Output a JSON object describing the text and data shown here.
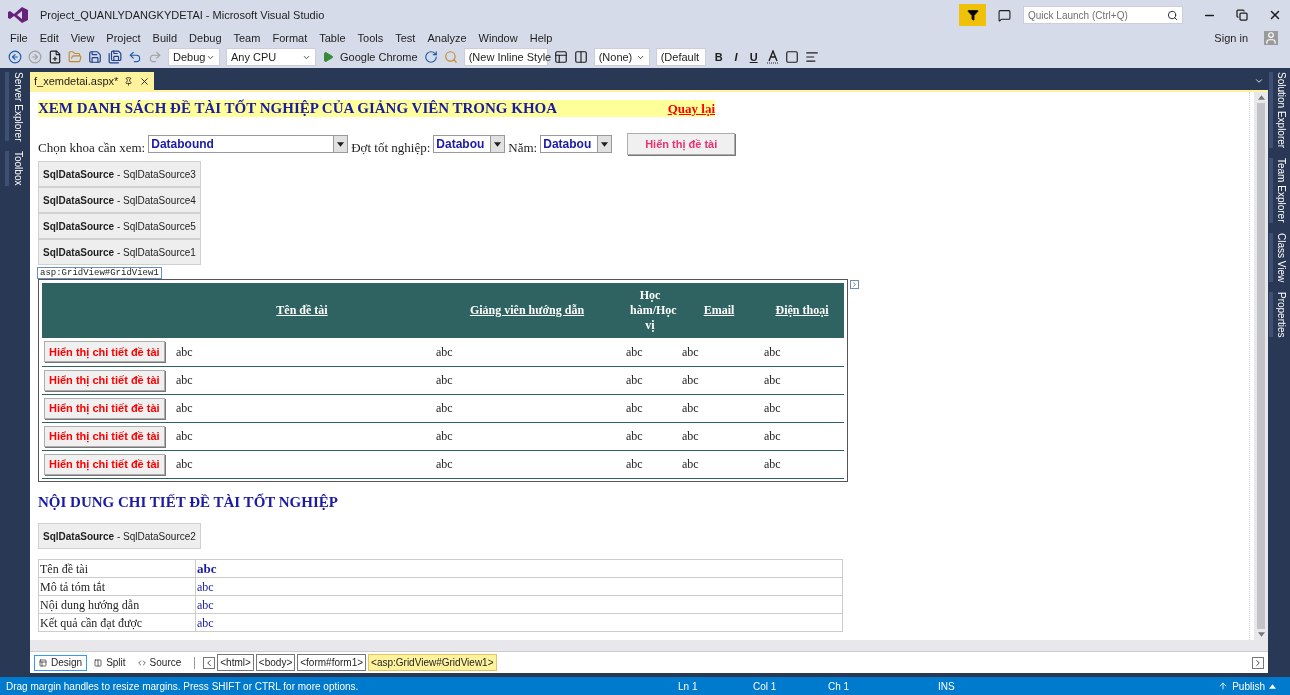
{
  "window": {
    "title": "Project_QUANLYDANGKYDETAI - Microsoft Visual Studio",
    "quick_launch": {
      "placeholder": "Quick Launch (Ctrl+Q)"
    },
    "sign_in": "Sign in"
  },
  "menu": [
    "File",
    "Edit",
    "View",
    "Project",
    "Build",
    "Debug",
    "Team",
    "Format",
    "Table",
    "Tools",
    "Test",
    "Analyze",
    "Window",
    "Help"
  ],
  "toolbar": {
    "configuration": "Debug",
    "platform": "Any CPU",
    "run_target": "Google Chrome",
    "style": "(New Inline Style",
    "target_rule": "(None)",
    "font": "(Default",
    "format_buttons": [
      "B",
      "I",
      "U"
    ]
  },
  "left_tool_tabs": [
    "Server Explorer",
    "Toolbox"
  ],
  "right_tool_tabs": [
    "Solution Explorer",
    "Team Explorer",
    "Class View",
    "Properties"
  ],
  "document_tabs": [
    {
      "title": "f_xemdetai.aspx*",
      "selected": true
    }
  ],
  "page": {
    "heading": "XEM DANH SÁCH ĐỀ TÀI TỐT NGHIỆP CỦA GIẢNG VIÊN TRONG KHOA",
    "back_link": "Quay lại",
    "filters": [
      {
        "label": "Chọn khoa cần xem:",
        "value": "Databound",
        "kind": "wide"
      },
      {
        "label": "Đợt tốt nghiệp:",
        "value": "Databou",
        "kind": "narrow"
      },
      {
        "label": "Năm:",
        "value": "Databou",
        "kind": "narrow"
      }
    ],
    "show_button": "Hiển thị đề tài",
    "data_sources": [
      {
        "label": "**SqlDataSource** - SqlDataSource3"
      },
      {
        "label": "**SqlDataSource** - SqlDataSource4"
      },
      {
        "label": "**SqlDataSource** - SqlDataSource5"
      },
      {
        "label": "**SqlDataSource** - SqlDataSource1"
      }
    ],
    "grid_tag": "asp:GridView#GridView1",
    "grid": {
      "columns": [
        "Tên đề tài",
        "Giảng viên hướng dẫn",
        "Học hàm/Học vị",
        "Email",
        "Điện thoại"
      ],
      "rows": [
        {
          "button": "Hiển thị chi tiết đề tài",
          "cells": [
            "abc",
            "abc",
            "abc",
            "abc",
            "abc"
          ]
        },
        {
          "button": "Hiển thị chi tiết đề tài",
          "cells": [
            "abc",
            "abc",
            "abc",
            "abc",
            "abc"
          ]
        },
        {
          "button": "Hiển thị chi tiết đề tài",
          "cells": [
            "abc",
            "abc",
            "abc",
            "abc",
            "abc"
          ]
        },
        {
          "button": "Hiển thị chi tiết đề tài",
          "cells": [
            "abc",
            "abc",
            "abc",
            "abc",
            "abc"
          ]
        },
        {
          "button": "Hiển thị chi tiết đề tài",
          "cells": [
            "abc",
            "abc",
            "abc",
            "abc",
            "abc"
          ]
        }
      ]
    },
    "detail_heading": "NỘI DUNG CHI TIẾT ĐỀ TÀI TỐT NGHIỆP",
    "detail_source": {
      "label": "**SqlDataSource** - SqlDataSource2"
    },
    "detail_rows": [
      {
        "label": "Tên đề tài",
        "value": "abc",
        "bold": true
      },
      {
        "label": "Mô tả tóm tắt",
        "value": "abc",
        "bold": false
      },
      {
        "label": "Nội dung hướng dẫn",
        "value": "abc",
        "bold": false
      },
      {
        "label": "Kết quả cần đạt được",
        "value": "abc",
        "bold": false
      }
    ]
  },
  "view_tabs": [
    {
      "label": "Design",
      "selected": true
    },
    {
      "label": "Split",
      "selected": false
    },
    {
      "label": "Source",
      "selected": false
    }
  ],
  "breadcrumb": [
    {
      "label": "<html>",
      "selected": false
    },
    {
      "label": "<body>",
      "selected": false
    },
    {
      "label": "<form#form1>",
      "selected": false
    },
    {
      "label": "<asp:GridView#GridView1>",
      "selected": true
    }
  ],
  "status_bar": {
    "message": "Drag margin handles to resize margins. Press SHIFT or CTRL for more options.",
    "line": "Ln 1",
    "column": "Col 1",
    "char": "Ch 1",
    "mode": "INS",
    "publish": "Publish"
  }
}
